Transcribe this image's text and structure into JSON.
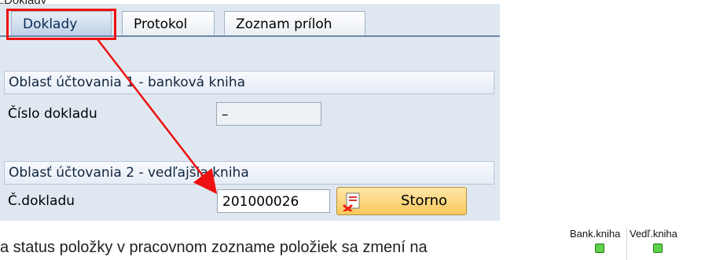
{
  "top_fragment": "„Doklady“",
  "tabs": [
    {
      "label": "Doklady",
      "active": true
    },
    {
      "label": "Protokol",
      "active": false
    },
    {
      "label": "Zoznam príloh",
      "active": false
    }
  ],
  "group1": {
    "title": "Oblasť účtovania 1 - banková kniha",
    "field_label": "Číslo dokladu",
    "field_value": "–"
  },
  "group2": {
    "title": "Oblasť účtovania 2 - vedľajšia kniha",
    "field_label": "Č.dokladu",
    "field_value": "201000026",
    "button_label": "Storno"
  },
  "bottom_text": "a status položky v pracovnom zozname položiek sa zmení na",
  "status_columns": [
    {
      "header": "Bank.kniha",
      "status": "green"
    },
    {
      "header": "Vedľ.kniha",
      "status": "green"
    }
  ],
  "icons": {
    "storno": "storno-document-icon",
    "led": "green-status-led-icon"
  },
  "colors": {
    "panel_bg": "#dfe8f1",
    "highlight_red": "#e11",
    "status_green": "#5fd14a",
    "button_yellow": "#f7c85d"
  }
}
